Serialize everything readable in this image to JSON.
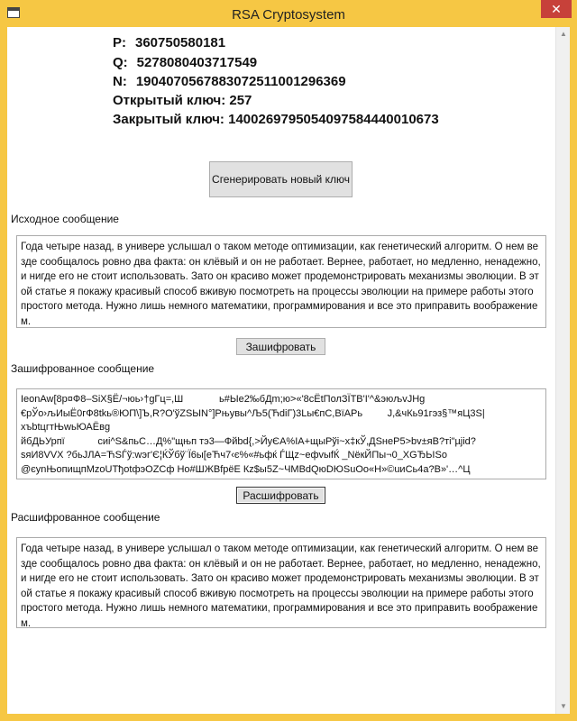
{
  "window": {
    "title": "RSA Cryptosystem",
    "close_glyph": "✕"
  },
  "keys": {
    "p_label": "P:",
    "p_value": "360750580181",
    "q_label": "Q:",
    "q_value": "5278080403717549",
    "n_label": "N:",
    "n_value": "1904070567883072511001296369",
    "public_label": "Открытый ключ:",
    "public_value": "257",
    "private_label": "Закрытый ключ:",
    "private_value": "1400269795054097584440010673"
  },
  "generate_button": "Сгенерировать новый ключ",
  "source": {
    "label": "Исходное сообщение",
    "text": "Года четыре назад, в универе услышал о таком методе оптимизации, как генетический алгоритм. О нем везде сообщалось ровно два факта: он клёвый и он не работает. Вернее, работает, но медленно, ненадежно, и нигде его не стоит использовать. Зато он красиво может продемонстрировать механизмы эволюции. В этой статье я покажу красивый способ вживую посмотреть на процессы эволюции на примере работы этого простого метода. Нужно лишь немного математики, программирования и все это приправить воображением."
  },
  "encrypt_button": "Зашифровать",
  "encrypted": {
    "label": "Зашифрованное сообщение",
    "text": "ІeonAw[8p¤Ф8–SiX§Ё/¬юь›†gГц=,Ш             ь#Ыe2‰бДm;ю>«'8сЁtПолЗЇТВ'І'^&эюљvJHg\n€рЎо›љИыЁ0гФ8tkь®ЮП\\]Ъ,R?О'ўZЅЫN°]Рњувы^Љ5(ЋdіГ)3Lы€пС,ВїАРь         J,&чКь91гэз§™яЦ3S|\nхъbtцгтЊwьЮАЁвg\nйбДЬУрпї            сиi^S&пьС…Д%\"щњп тэ3—Фйbd{,>ЙуЄА%ІА+щыРўі~х‡кЎ,ДЅнеР5>bv±яВ?ті\"µjid?\nsяИ8VVX ?бьЈЛА=ЋЅЃў:wэг'Є¦ЌЎбў¨Ї6ы[еЋч7‹є%«#ьфќ ЃЩz~ефvыfЌ _NёкЙПы¬0_XGЂЬІЅо\n@єуnЊопищпМzоUТђotфэОZСф Нo#ШЖВfрёЕ Кz$ы5Z~ЧМВdQюDЮЅuОо«Н»©uиСь4а?В»'…^Ц\n                                                                     '      ''"
  },
  "decrypt_button": "Расшифровать",
  "decrypted": {
    "label": "Расшифрованное сообщение",
    "text": "Года четыре назад, в универе услышал о таком методе оптимизации, как генетический алгоритм. О нем везде сообщалось ровно два факта: он клёвый и он не работает. Вернее, работает, но медленно, ненадежно, и нигде его не стоит использовать. Зато он красиво может продемонстрировать механизмы эволюции. В этой статье я покажу красивый способ вживую посмотреть на процессы эволюции на примере работы этого простого метода. Нужно лишь немного математики, программирования и все это приправить воображением."
  },
  "icons": {
    "app": "window-app-icon",
    "close": "close-icon",
    "scroll_up": "chevron-up-icon",
    "scroll_down": "chevron-down-icon"
  }
}
